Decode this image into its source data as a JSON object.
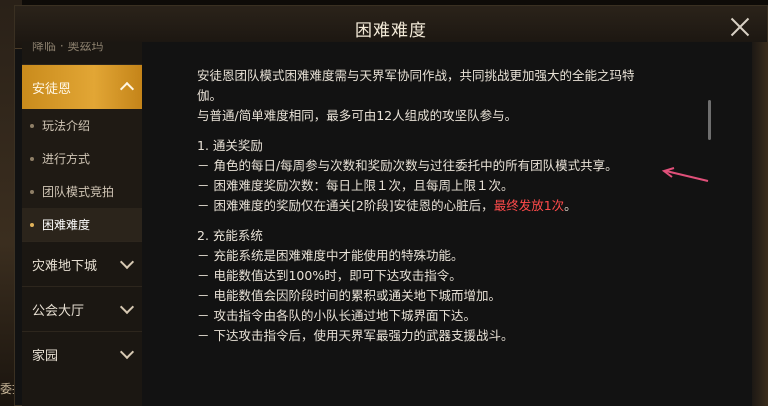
{
  "background": {
    "left_snippet": "委托"
  },
  "window": {
    "title": "困难难度",
    "close_icon": "close-icon"
  },
  "sidebar": {
    "items": [
      {
        "label": "降临 · 奥兹玛",
        "state": "partially-visible"
      },
      {
        "label": "安徒恩",
        "active": true,
        "children": [
          "玩法介绍",
          "进行方式",
          "团队模式竞拍",
          "困难难度"
        ],
        "selected_child": "困难难度"
      },
      {
        "label": "灾难地下城"
      },
      {
        "label": "公会大厅"
      },
      {
        "label": "家园"
      }
    ]
  },
  "content": {
    "intro": [
      "安徒恩团队模式困难难度需与天界军协同作战，共同挑战更加强大的全能之玛特",
      "伽。",
      "与普通/简单难度相同，最多可由12人组成的攻坚队参与。"
    ],
    "sections": [
      {
        "title": "1. 通关奖励",
        "lines": [
          "－ 角色的每日/每周参与次数和奖励次数与过往委托中的所有团队模式共享。",
          "－ 困难难度奖励次数：每日上限１次，且每周上限１次。"
        ],
        "last_line_prefix": "－ 困难难度的奖励仅在通关[2阶段]安徒恩的心脏后，",
        "last_line_red": "最终发放1次",
        "last_line_suffix": "。"
      },
      {
        "title": "2. 充能系统",
        "lines": [
          "－ 充能系统是困难难度中才能使用的特殊功能。",
          "－ 电能数值达到100%时，即可下达攻击指令。",
          "－ 电能数值会因阶段时间的累积或通关地下城而增加。",
          "－ 攻击指令由各队的小队长通过地下城界面下达。",
          "－ 下达攻击指令后，使用天界军最强力的武器支援战斗。"
        ]
      }
    ]
  },
  "colors": {
    "accent_gold": "#d89a27",
    "highlight_red": "#ff4b4b",
    "annotation_pink": "#e0507a"
  }
}
